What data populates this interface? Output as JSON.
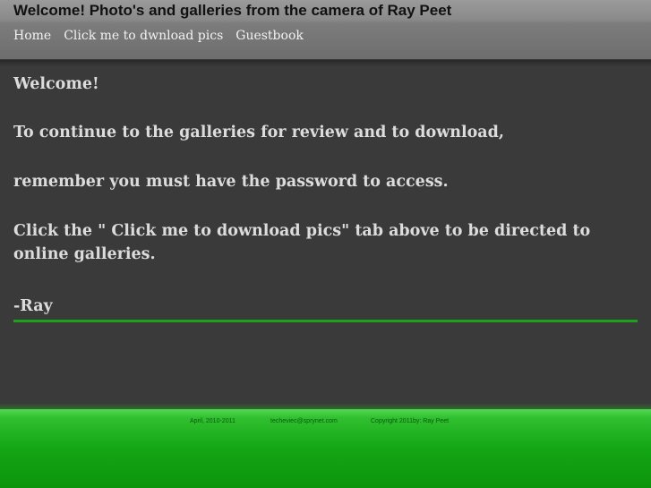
{
  "header": {
    "title": "Welcome!  Photo's and galleries from the camera of Ray Peet"
  },
  "nav": {
    "items": [
      {
        "label": "Home"
      },
      {
        "label": "Click me to dwnload pics"
      },
      {
        "label": "Guestbook"
      }
    ]
  },
  "content": {
    "welcome": "Welcome!",
    "line1": "To continue to the galleries for review and to download,",
    "line2": "remember you must have the password to access.",
    "line3": "Click the \" Click me to download pics\" tab above to be directed to online galleries.",
    "signature": "-Ray"
  },
  "footer": {
    "dates": "April, 2010-2011",
    "email": "techeviec@sprynet.com",
    "copyright": "Copyright  2011by:  Ray Peet"
  },
  "colors": {
    "accent_green": "#1aa21a",
    "footer_green": "#14a514",
    "background": "#3a3a3a"
  }
}
